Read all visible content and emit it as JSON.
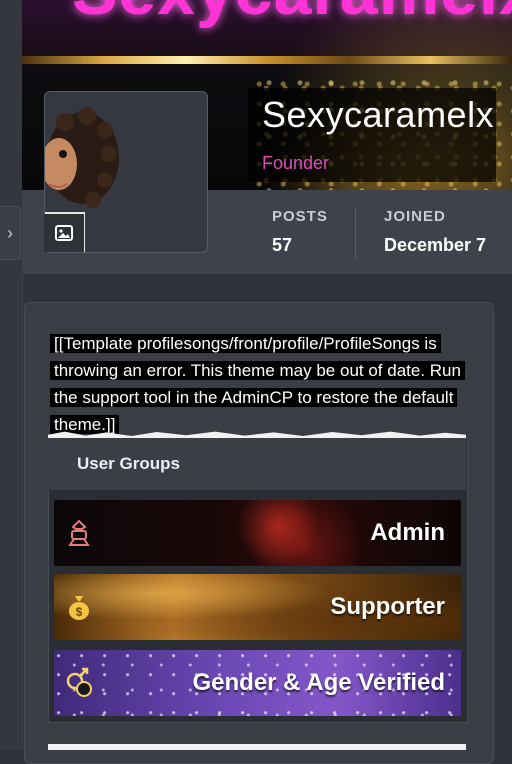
{
  "cover": {
    "title": "Sexycaramelx"
  },
  "profile": {
    "name": "Sexycaramelx",
    "role": "Founder",
    "role_color": "#d64fb9"
  },
  "stats": {
    "posts_label": "POSTS",
    "posts_value": "57",
    "joined_label": "JOINED",
    "joined_value": "December 7"
  },
  "error": {
    "message": "[[Template profilesongs/front/profile/ProfileSongs is throwing an error. This theme may be out of date. Run the support tool in the AdminCP to restore the default theme.]]"
  },
  "groups": {
    "title": "User Groups",
    "items": [
      {
        "label": "Admin",
        "icon": "admin-icon"
      },
      {
        "label": "Supporter",
        "icon": "money-bag-icon"
      },
      {
        "label": "Gender & Age Verified",
        "icon": "gender-verified-icon"
      }
    ]
  },
  "icons": {
    "collapse": "chevron-right-icon",
    "photo": "image-icon"
  }
}
